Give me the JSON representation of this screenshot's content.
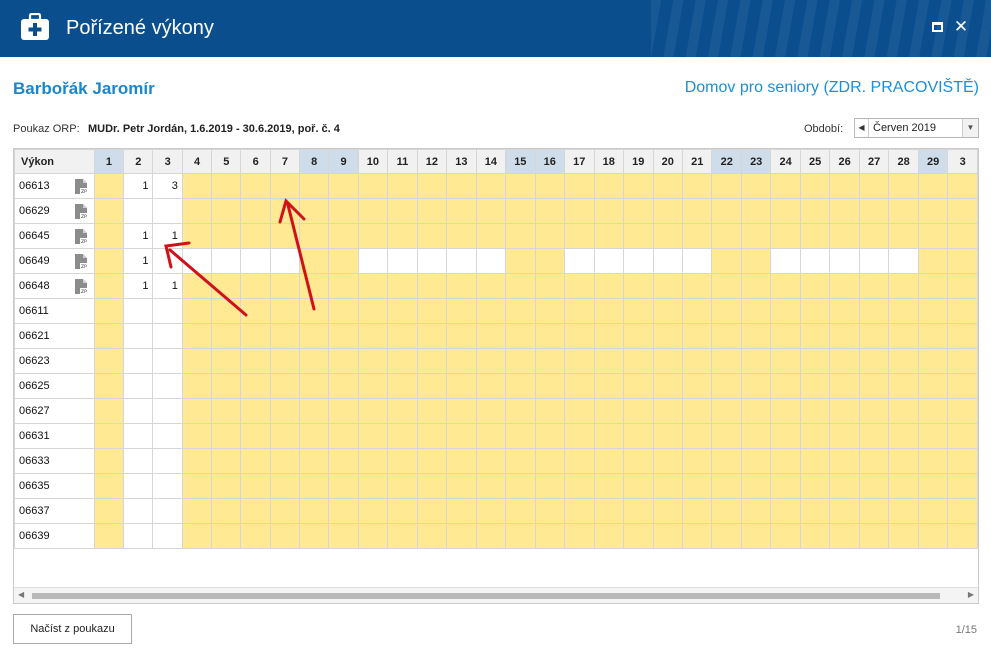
{
  "window": {
    "title": "Pořízené výkony",
    "maximize_icon": "maximize-icon",
    "close_label": "✕"
  },
  "patient": {
    "name": "Barbořák Jaromír",
    "facility": "Domov pro seniory (ZDR. PRACOVIŠTĚ)"
  },
  "orp": {
    "label": "Poukaz ORP:",
    "value": "MUDr. Petr Jordán, 1.6.2019 - 30.6.2019, poř. č. 4"
  },
  "period": {
    "label": "Období:",
    "value": "Červen 2019"
  },
  "grid": {
    "code_header": "Výkon",
    "days": [
      "1",
      "2",
      "3",
      "4",
      "5",
      "6",
      "7",
      "8",
      "9",
      "10",
      "11",
      "12",
      "13",
      "14",
      "15",
      "16",
      "17",
      "18",
      "19",
      "20",
      "21",
      "22",
      "23",
      "24",
      "25",
      "26",
      "27",
      "28",
      "29",
      "3"
    ],
    "weekend_days": [
      1,
      8,
      9,
      15,
      16,
      22,
      23,
      29
    ],
    "rows": [
      {
        "code": "06613",
        "has_doc": true,
        "values": {
          "2": "1",
          "3": "3"
        },
        "white_days": [
          2,
          3
        ]
      },
      {
        "code": "06629",
        "has_doc": true,
        "values": {},
        "white_days": [
          2,
          3
        ]
      },
      {
        "code": "06645",
        "has_doc": true,
        "values": {
          "2": "1",
          "3": "1"
        },
        "white_days": [
          2,
          3
        ]
      },
      {
        "code": "06649",
        "has_doc": true,
        "values": {
          "2": "1"
        },
        "white_days": [
          2,
          3,
          4,
          5,
          6,
          7,
          10,
          11,
          12,
          13,
          14,
          17,
          18,
          19,
          20,
          21,
          24,
          25,
          26,
          27,
          28
        ]
      },
      {
        "code": "06648",
        "has_doc": true,
        "values": {
          "2": "1",
          "3": "1"
        },
        "white_days": [
          2,
          3
        ]
      },
      {
        "code": "06611",
        "has_doc": false,
        "values": {},
        "white_days": [
          2,
          3
        ]
      },
      {
        "code": "06621",
        "has_doc": false,
        "values": {},
        "white_days": [
          2,
          3
        ]
      },
      {
        "code": "06623",
        "has_doc": false,
        "values": {},
        "white_days": [
          2,
          3
        ]
      },
      {
        "code": "06625",
        "has_doc": false,
        "values": {},
        "white_days": [
          2,
          3
        ]
      },
      {
        "code": "06627",
        "has_doc": false,
        "values": {},
        "white_days": [
          2,
          3
        ]
      },
      {
        "code": "06631",
        "has_doc": false,
        "values": {},
        "white_days": [
          2,
          3
        ]
      },
      {
        "code": "06633",
        "has_doc": false,
        "values": {},
        "white_days": [
          2,
          3
        ]
      },
      {
        "code": "06635",
        "has_doc": false,
        "values": {},
        "white_days": [
          2,
          3
        ]
      },
      {
        "code": "06637",
        "has_doc": false,
        "values": {},
        "white_days": [
          2,
          3
        ]
      },
      {
        "code": "06639",
        "has_doc": false,
        "values": {},
        "white_days": [
          2,
          3
        ]
      }
    ],
    "doc_icon": "zp-document-icon"
  },
  "footer": {
    "load_button": "Načíst z poukazu",
    "pager": "1/15"
  },
  "colors": {
    "titlebar": "#0a4e8e",
    "accent": "#1c86c9",
    "cell_fill": "#ffe992",
    "weekend_header": "#cfdce9",
    "annotation_arrow": "#d0111a"
  }
}
